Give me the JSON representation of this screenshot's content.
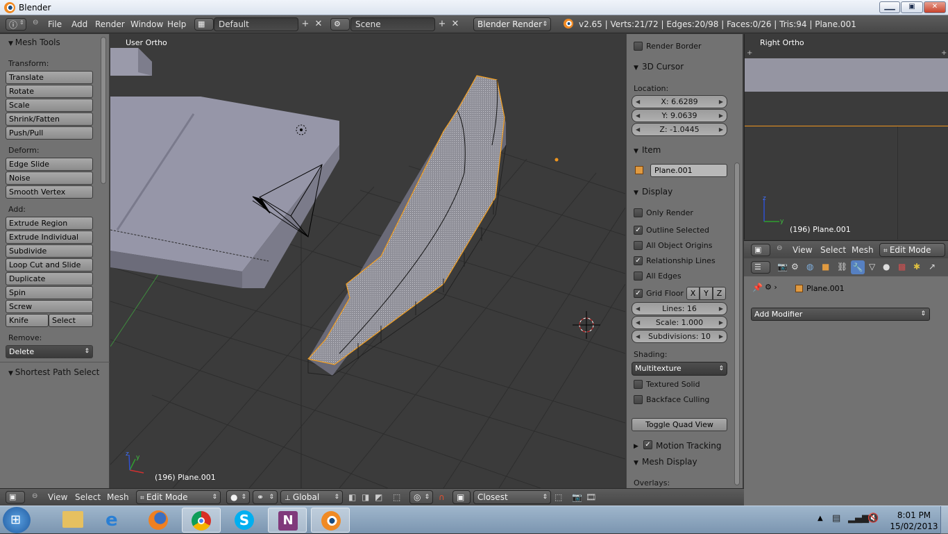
{
  "window": {
    "title": "Blender",
    "minimize_label": "▁▁",
    "maximize_label": "▣",
    "close_label": "✕"
  },
  "header": {
    "menus": [
      "File",
      "Add",
      "Render",
      "Window",
      "Help"
    ],
    "layout": "Default",
    "scene": "Scene",
    "engine": "Blender Render",
    "stats": "v2.65 | Verts:21/72 | Edges:20/98 | Faces:0/26 | Tris:94 | Plane.001"
  },
  "toolshelf": {
    "title": "Mesh Tools",
    "transform_label": "Transform:",
    "transform": [
      "Translate",
      "Rotate",
      "Scale",
      "Shrink/Fatten",
      "Push/Pull"
    ],
    "deform_label": "Deform:",
    "deform": [
      "Edge Slide",
      "Noise",
      "Smooth Vertex"
    ],
    "add_label": "Add:",
    "add": [
      "Extrude Region",
      "Extrude Individual",
      "Subdivide",
      "Loop Cut and Slide",
      "Duplicate",
      "Spin",
      "Screw"
    ],
    "knife": "Knife",
    "select": "Select",
    "remove_label": "Remove:",
    "delete": "Delete",
    "shortest_path": "Shortest Path Select"
  },
  "viewport": {
    "label": "User Ortho",
    "object_label": "(196) Plane.001"
  },
  "properties": {
    "render_border": "Render Border",
    "cursor_title": "3D Cursor",
    "location_label": "Location:",
    "x": "X: 6.6289",
    "y": "Y: 9.0639",
    "z": "Z: -1.0445",
    "item_title": "Item",
    "item_name": "Plane.001",
    "display_title": "Display",
    "only_render": "Only Render",
    "outline_selected": "Outline Selected",
    "all_object_origins": "All Object Origins",
    "relationship_lines": "Relationship Lines",
    "all_edges": "All Edges",
    "grid_floor": "Grid Floor",
    "axis_x": "X",
    "axis_y": "Y",
    "axis_z": "Z",
    "lines": "Lines: 16",
    "scale": "Scale: 1.000",
    "subdivisions": "Subdivisions: 10",
    "shading_label": "Shading:",
    "shading": "Multitexture",
    "textured_solid": "Textured Solid",
    "backface_culling": "Backface Culling",
    "toggle_quad": "Toggle Quad View",
    "motion_tracking": "Motion Tracking",
    "mesh_display": "Mesh Display",
    "overlays": "Overlays:"
  },
  "right_view": {
    "label": "Right Ortho",
    "object_label": "(196) Plane.001",
    "menus": [
      "View",
      "Select",
      "Mesh"
    ],
    "mode": "Edit Mode",
    "object": "Plane.001",
    "add_modifier": "Add Modifier"
  },
  "bottom": {
    "menus": [
      "View",
      "Select",
      "Mesh"
    ],
    "mode": "Edit Mode",
    "orientation": "Global",
    "snap": "Closest"
  },
  "taskbar": {
    "time": "8:01 PM",
    "date": "15/02/2013"
  },
  "colors": {
    "accent": "#f0961e",
    "selected_edge": "#f5a020",
    "panel": "#727272",
    "viewport": "#3b3b3b"
  }
}
